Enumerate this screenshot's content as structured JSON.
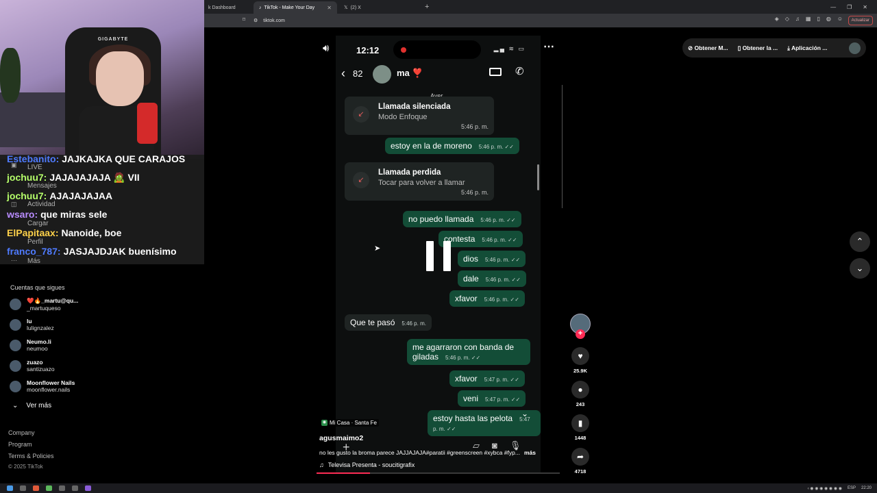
{
  "browser": {
    "tabs": [
      {
        "label": "k Dashboard",
        "active": false
      },
      {
        "label": "TikTok - Make Your Day",
        "active": true
      },
      {
        "label": "(2) X",
        "active": false
      }
    ],
    "url": "tiktok.com",
    "update_label": "Actualizar"
  },
  "chat": {
    "lines": [
      {
        "user": "Estebanito:",
        "msg": "JAJKAJKA QUE CARAJOS",
        "color": "#4f7bff"
      },
      {
        "user": "jochuu7:",
        "msg": "JAJAJAJAJA 🧟 VII",
        "color": "#b6ff6a"
      },
      {
        "user": "jochuu7:",
        "msg": "AJAJAJAJAA",
        "color": "#b6ff6a"
      },
      {
        "user": "wsaro:",
        "msg": "que miras sele",
        "color": "#b98cff"
      },
      {
        "user": "ElPapitaax:",
        "msg": "Nanoide, boe",
        "color": "#ffd24a"
      },
      {
        "user": "franco_787:",
        "msg": "JASJAJDJAK buenísimo",
        "color": "#4f7bff"
      }
    ],
    "nav_ghosts": [
      "LIVE",
      "Mensajes",
      "Actividad",
      "Cargar",
      "Perfil",
      "Más"
    ]
  },
  "sidebar": {
    "following_title": "Cuentas que sigues",
    "following": [
      {
        "name": "❤️🔥_martu@qu...",
        "handle": "_martuqueso"
      },
      {
        "name": "lu",
        "handle": "lulignzalez"
      },
      {
        "name": "Neumo.li",
        "handle": "neumoo"
      },
      {
        "name": "zuazo",
        "handle": "santizuazo"
      },
      {
        "name": "Moonflower Nails",
        "handle": "moonflower.nails"
      }
    ],
    "see_more": "Ver más",
    "footer": [
      "Company",
      "Program",
      "Terms & Policies"
    ],
    "copyright": "© 2025 TikTok"
  },
  "phone": {
    "time": "12:12",
    "back_count": "82",
    "contact_name": "ma ❣️",
    "date_chip": "Ayer",
    "call1": {
      "title": "Llamada silenciada",
      "subtitle": "Modo Enfoque",
      "time": "5:46 p. m."
    },
    "call2": {
      "title": "Llamada perdida",
      "subtitle": "Tocar para volver a llamar",
      "time": "5:46 p. m."
    },
    "messages": [
      {
        "dir": "out",
        "text": "estoy en la de moreno",
        "time": "5:46 p. m. ✓✓"
      },
      {
        "dir": "out",
        "text": "no puedo llamada",
        "time": "5:46 p. m. ✓✓"
      },
      {
        "dir": "out",
        "text": "contesta",
        "time": "5:46 p. m. ✓✓"
      },
      {
        "dir": "out",
        "text": "dios",
        "time": "5:46 p. m. ✓✓"
      },
      {
        "dir": "out",
        "text": "dale",
        "time": "5:46 p. m. ✓✓"
      },
      {
        "dir": "out",
        "text": "xfavor",
        "time": "5:46 p. m. ✓✓"
      },
      {
        "dir": "in",
        "text": "Que te pasó",
        "time": "5:46 p. m."
      },
      {
        "dir": "out",
        "text": "me agarraron con banda de giladas",
        "time": "5:46 p. m. ✓✓"
      },
      {
        "dir": "out",
        "text": "xfavor",
        "time": "5:47 p. m. ✓✓"
      },
      {
        "dir": "out",
        "text": "veni",
        "time": "5:47 p. m. ✓✓"
      },
      {
        "dir": "out",
        "text": "estoy hasta las pelota",
        "time": "5:47 p. m. ✓✓"
      }
    ]
  },
  "video": {
    "location": "Mi Casa · Santa Fe",
    "author": "agusmaimo2",
    "caption": "no les gusto la broma parece JAJJAJAJA#paratii #greenscreen #xybca #fyp...",
    "caption_more": "más",
    "music": "Televisa Presenta - soucitigrafix",
    "progress": 0.22
  },
  "actions": {
    "likes": "25.9K",
    "comments": "243",
    "saves": "1448",
    "shares": "4718"
  },
  "top_right": {
    "items": [
      "Obtener M...",
      "Obtener la ...",
      "Aplicación ..."
    ]
  },
  "taskbar": {
    "lang": "ESP",
    "clock": "22:20"
  }
}
